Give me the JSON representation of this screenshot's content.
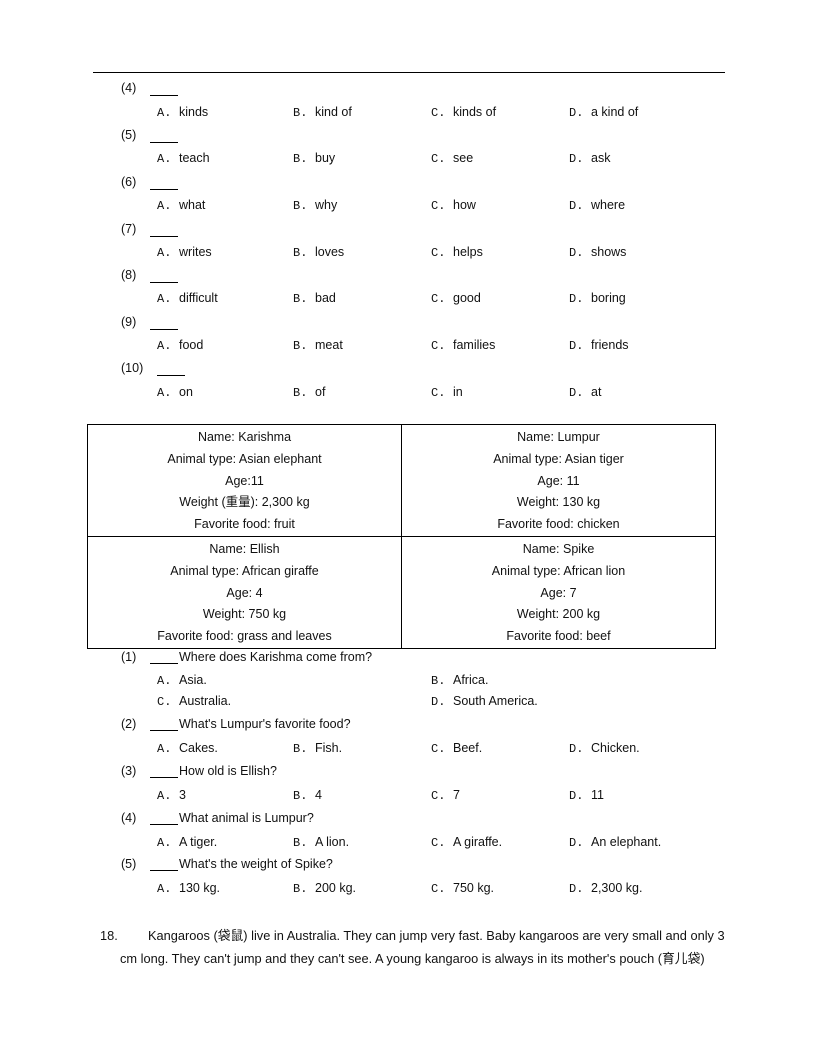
{
  "section_a": {
    "questions": [
      {
        "number": "(4)",
        "options": [
          {
            "letter": "A.",
            "text": "kinds"
          },
          {
            "letter": "B.",
            "text": "kind of"
          },
          {
            "letter": "C.",
            "text": "kinds of"
          },
          {
            "letter": "D.",
            "text": "a kind of"
          }
        ]
      },
      {
        "number": "(5)",
        "options": [
          {
            "letter": "A.",
            "text": "teach"
          },
          {
            "letter": "B.",
            "text": "buy"
          },
          {
            "letter": "C.",
            "text": "see"
          },
          {
            "letter": "D.",
            "text": "ask"
          }
        ]
      },
      {
        "number": "(6)",
        "options": [
          {
            "letter": "A.",
            "text": "what"
          },
          {
            "letter": "B.",
            "text": "why"
          },
          {
            "letter": "C.",
            "text": "how"
          },
          {
            "letter": "D.",
            "text": "where"
          }
        ]
      },
      {
        "number": "(7)",
        "options": [
          {
            "letter": "A.",
            "text": "writes"
          },
          {
            "letter": "B.",
            "text": "loves"
          },
          {
            "letter": "C.",
            "text": "helps"
          },
          {
            "letter": "D.",
            "text": "shows"
          }
        ]
      },
      {
        "number": "(8)",
        "options": [
          {
            "letter": "A.",
            "text": "difficult"
          },
          {
            "letter": "B.",
            "text": "bad"
          },
          {
            "letter": "C.",
            "text": "good"
          },
          {
            "letter": "D.",
            "text": "boring"
          }
        ]
      },
      {
        "number": "(9)",
        "options": [
          {
            "letter": "A.",
            "text": "food"
          },
          {
            "letter": "B.",
            "text": "meat"
          },
          {
            "letter": "C.",
            "text": "families"
          },
          {
            "letter": "D.",
            "text": "friends"
          }
        ]
      },
      {
        "number": "(10)",
        "options": [
          {
            "letter": "A.",
            "text": "on"
          },
          {
            "letter": "B.",
            "text": "of"
          },
          {
            "letter": "C.",
            "text": "in"
          },
          {
            "letter": "D.",
            "text": "at"
          }
        ]
      }
    ]
  },
  "animal_table": {
    "cells": [
      {
        "name": "Name: Karishma",
        "type": "Animal type: Asian elephant",
        "age": "Age:11",
        "weight": "Weight (重量): 2,300 kg",
        "food": "Favorite food: fruit"
      },
      {
        "name": "Name: Lumpur",
        "type": "Animal type: Asian tiger",
        "age": "Age: 11",
        "weight": "Weight: 130 kg",
        "food": "Favorite food: chicken"
      },
      {
        "name": "Name: Ellish",
        "type": "Animal type: African giraffe",
        "age": "Age: 4",
        "weight": "Weight: 750 kg",
        "food": "Favorite food: grass and leaves"
      },
      {
        "name": "Name: Spike",
        "type": "Animal type: African lion",
        "age": "Age: 7",
        "weight": "Weight: 200 kg",
        "food": "Favorite food: beef"
      }
    ]
  },
  "section_b": {
    "questions": [
      {
        "number": "(1)",
        "text": "Where does Karishma come from?",
        "options": [
          {
            "letter": "A.",
            "text": "Asia."
          },
          {
            "letter": "B.",
            "text": "Africa."
          },
          {
            "letter": "C.",
            "text": "Australia."
          },
          {
            "letter": "D.",
            "text": "South America."
          }
        ]
      },
      {
        "number": "(2)",
        "text": "What's Lumpur's favorite food?",
        "options": [
          {
            "letter": "A.",
            "text": "Cakes."
          },
          {
            "letter": "B.",
            "text": "Fish."
          },
          {
            "letter": "C.",
            "text": "Beef."
          },
          {
            "letter": "D.",
            "text": "Chicken."
          }
        ]
      },
      {
        "number": "(3)",
        "text": "How old is Ellish?",
        "options": [
          {
            "letter": "A.",
            "text": "3"
          },
          {
            "letter": "B.",
            "text": "4"
          },
          {
            "letter": "C.",
            "text": "7"
          },
          {
            "letter": "D.",
            "text": "11"
          }
        ]
      },
      {
        "number": "(4)",
        "text": "What animal is Lumpur?",
        "options": [
          {
            "letter": "A.",
            "text": "A tiger."
          },
          {
            "letter": "B.",
            "text": "A lion."
          },
          {
            "letter": "C.",
            "text": "A giraffe."
          },
          {
            "letter": "D.",
            "text": "An elephant."
          }
        ]
      },
      {
        "number": "(5)",
        "text": "What's the weight of Spike?",
        "options": [
          {
            "letter": "A.",
            "text": "130 kg."
          },
          {
            "letter": "B.",
            "text": "200 kg."
          },
          {
            "letter": "C.",
            "text": "750 kg."
          },
          {
            "letter": "D.",
            "text": "2,300 kg."
          }
        ]
      }
    ]
  },
  "passage_18": {
    "number": "18.",
    "line1": "Kangaroos (袋鼠) live in Australia. They can jump very fast. Baby kangaroos are very small and only 3",
    "line2": "cm long. They can't jump and they can't see. A young kangaroo is always in its mother's pouch (育儿袋)"
  }
}
